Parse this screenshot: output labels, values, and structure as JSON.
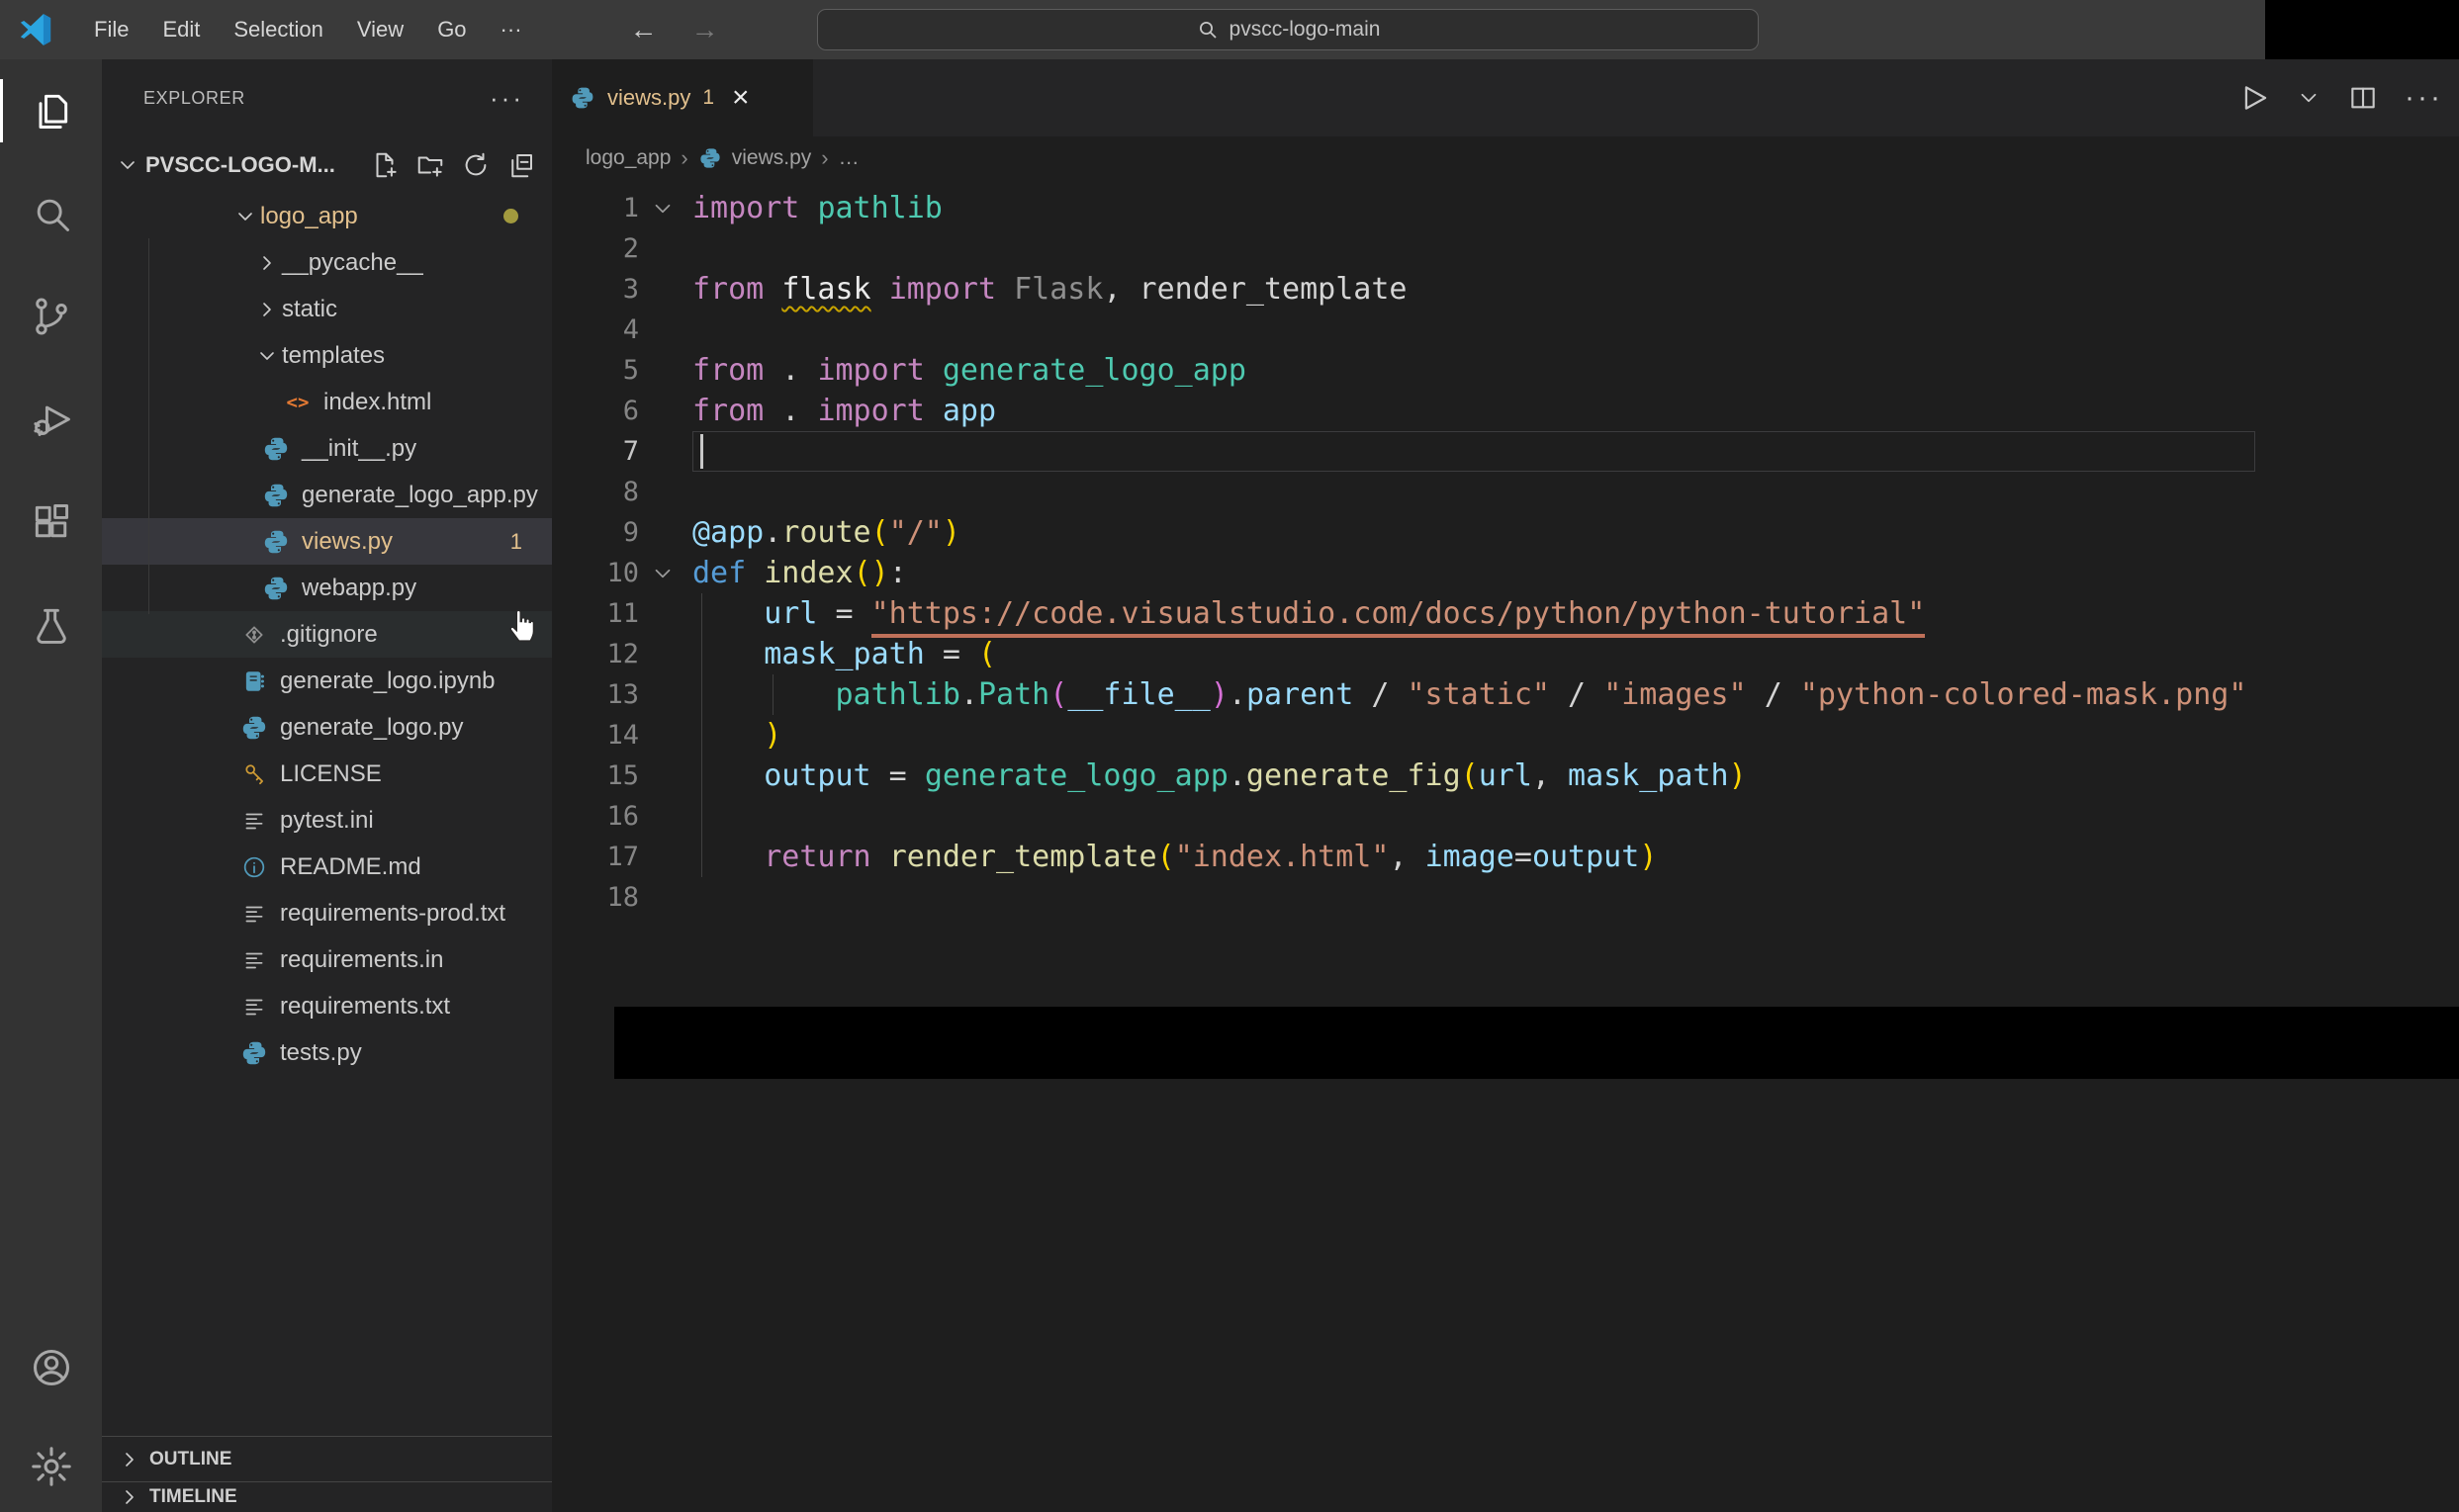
{
  "titlebar": {
    "menus": [
      "File",
      "Edit",
      "Selection",
      "View",
      "Go",
      "···"
    ],
    "command_center": {
      "query": "pvscc-logo-main",
      "icon": "search-icon"
    },
    "nav": {
      "back": "←",
      "forward": "→"
    }
  },
  "activity_bar": {
    "top_items": [
      {
        "id": "explorer",
        "icon": "files-icon",
        "active": true
      },
      {
        "id": "search",
        "icon": "search-icon",
        "active": false
      },
      {
        "id": "source-control",
        "icon": "source-control-icon",
        "active": false
      },
      {
        "id": "run-debug",
        "icon": "debug-icon",
        "active": false
      },
      {
        "id": "extensions",
        "icon": "extensions-icon",
        "active": false
      },
      {
        "id": "testing",
        "icon": "beaker-icon",
        "active": false
      }
    ],
    "bottom_items": [
      {
        "id": "account",
        "icon": "account-icon"
      },
      {
        "id": "settings",
        "icon": "gear-icon"
      }
    ]
  },
  "explorer": {
    "title": "EXPLORER",
    "header_more": "···",
    "root_label": "PVSCC-LOGO-M...",
    "root_actions": [
      "new-file",
      "new-folder",
      "refresh",
      "collapse-all"
    ],
    "tree": [
      {
        "label": "logo_app",
        "level": 0,
        "type": "folder",
        "chevron": "down",
        "gold": true,
        "dot": true
      },
      {
        "label": "__pycache__",
        "level": 1,
        "type": "folder",
        "chevron": "right"
      },
      {
        "label": "static",
        "level": 1,
        "type": "folder",
        "chevron": "right"
      },
      {
        "label": "templates",
        "level": 1,
        "type": "folder",
        "chevron": "down"
      },
      {
        "label": "index.html",
        "level": 2,
        "type": "file",
        "icon": "html"
      },
      {
        "label": "__init__.py",
        "level": 1,
        "type": "file",
        "icon": "python"
      },
      {
        "label": "generate_logo_app.py",
        "level": 1,
        "type": "file",
        "icon": "python"
      },
      {
        "label": "views.py",
        "level": 1,
        "type": "file",
        "icon": "python",
        "gold": true,
        "badge": "1",
        "selected": true
      },
      {
        "label": "webapp.py",
        "level": 1,
        "type": "file",
        "icon": "python"
      },
      {
        "label": ".gitignore",
        "level": 0,
        "type": "file",
        "icon": "git",
        "hovered": true
      },
      {
        "label": "generate_logo.ipynb",
        "level": 0,
        "type": "file",
        "icon": "notebook"
      },
      {
        "label": "generate_logo.py",
        "level": 0,
        "type": "file",
        "icon": "python"
      },
      {
        "label": "LICENSE",
        "level": 0,
        "type": "file",
        "icon": "key"
      },
      {
        "label": "pytest.ini",
        "level": 0,
        "type": "file",
        "icon": "list"
      },
      {
        "label": "README.md",
        "level": 0,
        "type": "file",
        "icon": "info"
      },
      {
        "label": "requirements-prod.txt",
        "level": 0,
        "type": "file",
        "icon": "list"
      },
      {
        "label": "requirements.in",
        "level": 0,
        "type": "file",
        "icon": "list"
      },
      {
        "label": "requirements.txt",
        "level": 0,
        "type": "file",
        "icon": "list"
      },
      {
        "label": "tests.py",
        "level": 0,
        "type": "file",
        "icon": "python"
      }
    ],
    "sections": [
      "OUTLINE",
      "TIMELINE"
    ]
  },
  "editor": {
    "tab": {
      "label": "views.py",
      "badge": "1",
      "close": "×",
      "icon": "python"
    },
    "actions": [
      "run",
      "run-dropdown",
      "split-editor",
      "more-actions"
    ],
    "breadcrumb": [
      "logo_app",
      "views.py",
      "…"
    ],
    "code": {
      "language": "python",
      "lines": [
        {
          "n": 1,
          "fold": true,
          "tokens": [
            [
              "kw",
              "import"
            ],
            [
              "pun",
              " "
            ],
            [
              "mod",
              "pathlib"
            ]
          ]
        },
        {
          "n": 2,
          "tokens": []
        },
        {
          "n": 3,
          "tokens": [
            [
              "kw",
              "from"
            ],
            [
              "pun",
              " "
            ],
            [
              "wsq",
              "flask"
            ],
            [
              "pun",
              " "
            ],
            [
              "kw",
              "import"
            ],
            [
              "pun",
              " "
            ],
            [
              "dim",
              "Flask"
            ],
            [
              "pun",
              ", render_template"
            ]
          ]
        },
        {
          "n": 4,
          "tokens": []
        },
        {
          "n": 5,
          "tokens": [
            [
              "kw",
              "from"
            ],
            [
              "pun",
              " . "
            ],
            [
              "kw",
              "import"
            ],
            [
              "pun",
              " "
            ],
            [
              "mod",
              "generate_logo_app"
            ]
          ]
        },
        {
          "n": 6,
          "tokens": [
            [
              "kw",
              "from"
            ],
            [
              "pun",
              " . "
            ],
            [
              "kw",
              "import"
            ],
            [
              "pun",
              " "
            ],
            [
              "var",
              "app"
            ]
          ]
        },
        {
          "n": 7,
          "cursor": true,
          "tokens": []
        },
        {
          "n": 8,
          "tokens": []
        },
        {
          "n": 9,
          "tokens": [
            [
              "var",
              "@app"
            ],
            [
              "pun",
              "."
            ],
            [
              "fn",
              "route"
            ],
            [
              "b1",
              "("
            ],
            [
              "str",
              "\"/\""
            ],
            [
              "b1",
              ")"
            ]
          ]
        },
        {
          "n": 10,
          "fold": true,
          "tokens": [
            [
              "def",
              "def"
            ],
            [
              "pun",
              " "
            ],
            [
              "fn",
              "index"
            ],
            [
              "b1",
              "()"
            ],
            [
              "pun",
              ":"
            ]
          ]
        },
        {
          "n": 11,
          "tokens": [
            [
              "pun",
              "    "
            ],
            [
              "var",
              "url"
            ],
            [
              "pun",
              " = "
            ],
            [
              "lnk",
              "\"https://code.visualstudio.com/docs/python/python-tutorial\""
            ]
          ]
        },
        {
          "n": 12,
          "tokens": [
            [
              "pun",
              "    "
            ],
            [
              "var",
              "mask_path"
            ],
            [
              "pun",
              " = "
            ],
            [
              "b1",
              "("
            ]
          ]
        },
        {
          "n": 13,
          "tokens": [
            [
              "pun",
              "        "
            ],
            [
              "mod",
              "pathlib"
            ],
            [
              "pun",
              "."
            ],
            [
              "mod",
              "Path"
            ],
            [
              "b2",
              "("
            ],
            [
              "var",
              "__file__"
            ],
            [
              "b2",
              ")"
            ],
            [
              "pun",
              "."
            ],
            [
              "var",
              "parent"
            ],
            [
              "pun",
              " / "
            ],
            [
              "str",
              "\"static\""
            ],
            [
              "pun",
              " / "
            ],
            [
              "str",
              "\"images\""
            ],
            [
              "pun",
              " / "
            ],
            [
              "str",
              "\"python-colored-mask.png\""
            ]
          ]
        },
        {
          "n": 14,
          "tokens": [
            [
              "pun",
              "    "
            ],
            [
              "b1",
              ")"
            ]
          ]
        },
        {
          "n": 15,
          "tokens": [
            [
              "pun",
              "    "
            ],
            [
              "var",
              "output"
            ],
            [
              "pun",
              " = "
            ],
            [
              "mod",
              "generate_logo_app"
            ],
            [
              "pun",
              "."
            ],
            [
              "fn",
              "generate_fig"
            ],
            [
              "b1",
              "("
            ],
            [
              "var",
              "url"
            ],
            [
              "pun",
              ", "
            ],
            [
              "var",
              "mask_path"
            ],
            [
              "b1",
              ")"
            ]
          ]
        },
        {
          "n": 16,
          "tokens": []
        },
        {
          "n": 17,
          "tokens": [
            [
              "pun",
              "    "
            ],
            [
              "kw",
              "return"
            ],
            [
              "pun",
              " "
            ],
            [
              "fn",
              "render_template"
            ],
            [
              "b1",
              "("
            ],
            [
              "str",
              "\"index.html\""
            ],
            [
              "pun",
              ", "
            ],
            [
              "var",
              "image"
            ],
            [
              "pun",
              "="
            ],
            [
              "var",
              "output"
            ],
            [
              "b1",
              ")"
            ]
          ]
        },
        {
          "n": 18,
          "tokens": []
        }
      ]
    },
    "overlays": {
      "redacted_region": true
    }
  },
  "colors": {
    "modified_gold": "#E2C08D",
    "selected_row_bg": "#37373d",
    "hover_row_bg": "#2a2d2e",
    "keyword": "#C586C0",
    "module": "#4EC9B0",
    "variable": "#9CDCFE",
    "function": "#DCDCAA",
    "string": "#CE9178",
    "bracket": "#FFD602"
  }
}
